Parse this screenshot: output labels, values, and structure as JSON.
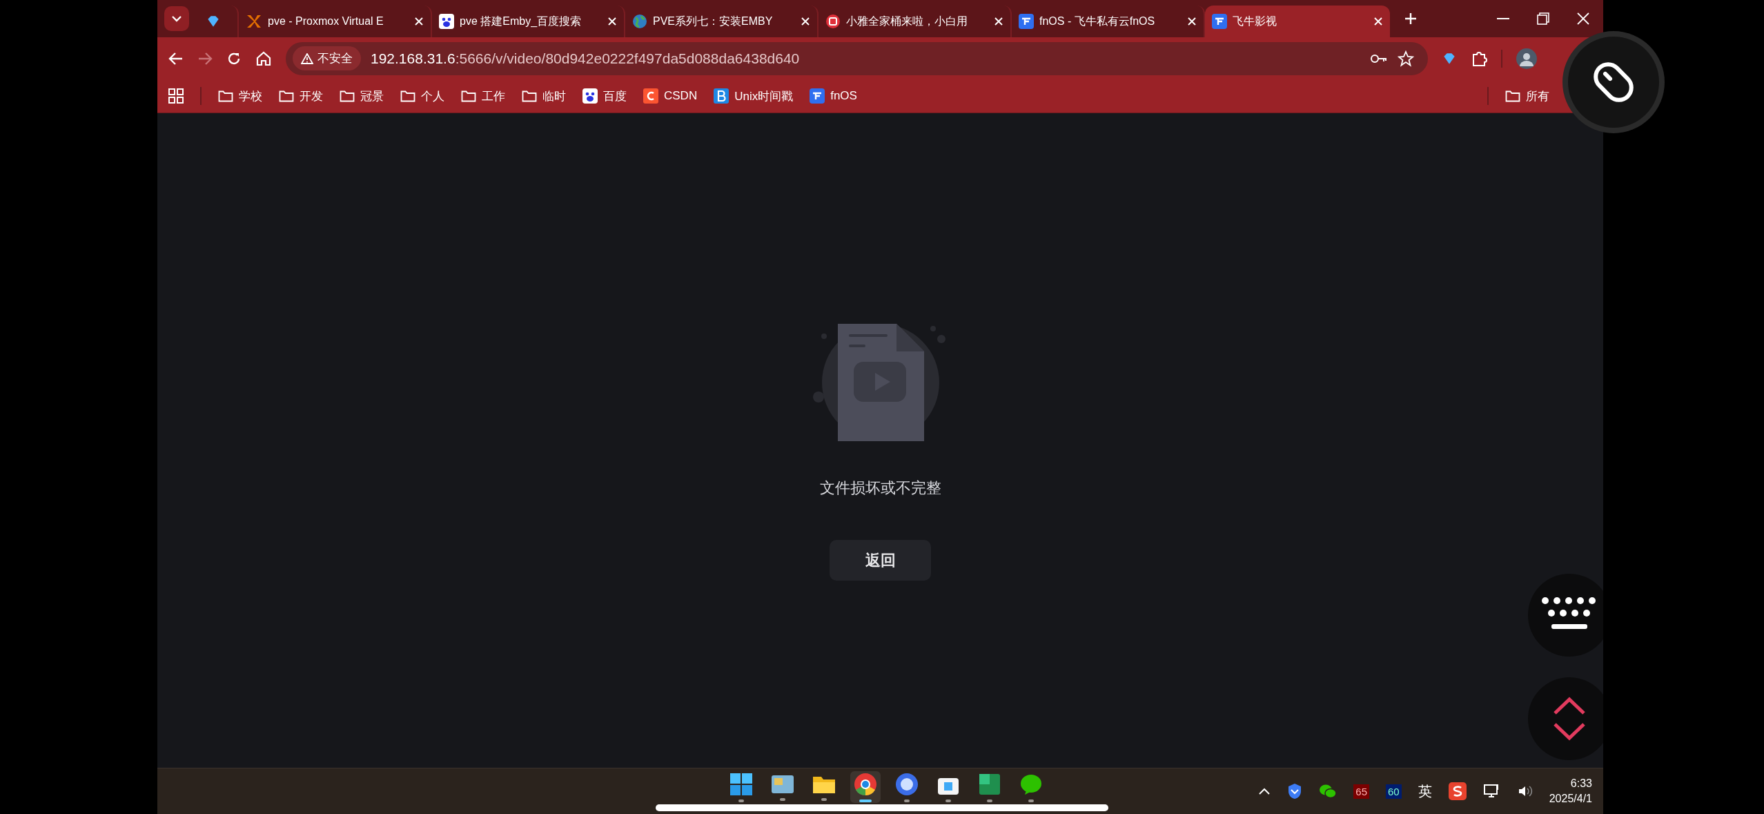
{
  "tabs": [
    {
      "kind": "diamond",
      "selected": false
    },
    {
      "kind": "proxmox",
      "title": "pve - Proxmox Virtual E",
      "selected": false
    },
    {
      "kind": "paw",
      "title": "pve 搭建Emby_百度搜索",
      "selected": false
    },
    {
      "kind": "globe",
      "title": "PVE系列七：安装EMBY",
      "selected": false
    },
    {
      "kind": "badge",
      "title": "小雅全家桶来啦，小白用",
      "selected": false
    },
    {
      "kind": "fnos",
      "title": "fnOS - 飞牛私有云fnOS",
      "selected": false
    },
    {
      "kind": "fnos",
      "title": "飞牛影视",
      "selected": true
    }
  ],
  "address": {
    "security": "不安全",
    "host": "192.168.31.6",
    "path": ":5666/v/video/80d942e0222f497da5d088da6438d640"
  },
  "bookmarks": [
    {
      "kind": "folder",
      "label": "学校"
    },
    {
      "kind": "folder",
      "label": "开发"
    },
    {
      "kind": "folder",
      "label": "冠景"
    },
    {
      "kind": "folder",
      "label": "个人"
    },
    {
      "kind": "folder",
      "label": "工作"
    },
    {
      "kind": "folder",
      "label": "临时"
    },
    {
      "kind": "paw",
      "label": "百度"
    },
    {
      "kind": "csdn",
      "label": "CSDN"
    },
    {
      "kind": "unix",
      "label": "Unix时间戳"
    },
    {
      "kind": "fnos",
      "label": "fnOS"
    }
  ],
  "other_bookmarks": "所有",
  "page": {
    "message": "文件损坏或不完整",
    "button": "返回"
  },
  "taskbar": {
    "apps": [
      {
        "kind": "windows",
        "selected": false
      },
      {
        "kind": "widgets",
        "selected": false
      },
      {
        "kind": "folder",
        "selected": false
      },
      {
        "kind": "chrome",
        "selected": true
      },
      {
        "kind": "blue",
        "selected": false
      },
      {
        "kind": "store",
        "selected": false
      },
      {
        "kind": "green",
        "selected": false
      },
      {
        "kind": "chat",
        "selected": false
      }
    ],
    "tray": {
      "badge_a": "65",
      "badge_b": "60",
      "ime": "英",
      "time": "6:33",
      "date": "2025/4/1"
    }
  }
}
